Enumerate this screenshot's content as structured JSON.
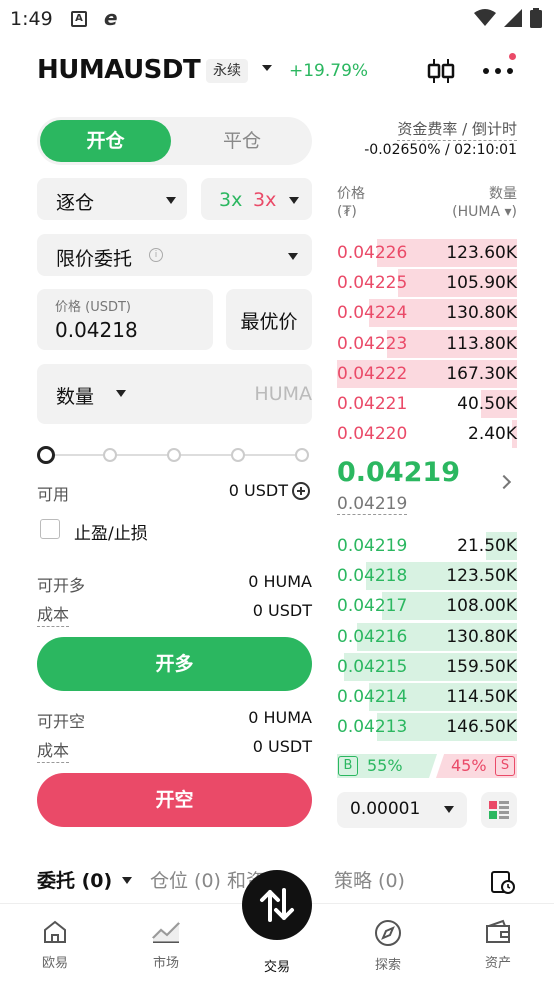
{
  "status_bar": {
    "time": "1:49",
    "icon_a": "A",
    "icon_e": "e"
  },
  "header": {
    "symbol": "HUMAUSDT",
    "contract_type": "永续",
    "change": "+19.79%"
  },
  "toggle": {
    "open": "开仓",
    "close": "平仓"
  },
  "funding": {
    "label": "资金费率 / 倒计时",
    "value": "-0.02650% / 02:10:01"
  },
  "form": {
    "margin_mode": "逐仓",
    "leverage_long": "3x",
    "leverage_short": "3x",
    "order_type": "限价委托",
    "price_label": "价格 (USDT)",
    "price_value": "0.04218",
    "best_price": "最优价",
    "qty_label": "数量",
    "qty_unit": "HUMA",
    "available_label": "可用",
    "available_value": "0 USDT",
    "tpsl_label": "止盈/止损",
    "long_max_label": "可开多",
    "long_max_value": "0 HUMA",
    "long_cost_label": "成本",
    "long_cost_value": "0 USDT",
    "long_button": "开多",
    "short_max_label": "可开空",
    "short_max_value": "0 HUMA",
    "short_cost_label": "成本",
    "short_cost_value": "0 USDT",
    "short_button": "开空"
  },
  "orderbook": {
    "price_header": "价格",
    "price_unit": "(₮)",
    "qty_header": "数量",
    "qty_unit": "(HUMA ▾)",
    "asks": [
      {
        "price": "0.04226",
        "qty": "123.60K",
        "depth": 0.78
      },
      {
        "price": "0.04225",
        "qty": "105.90K",
        "depth": 0.66
      },
      {
        "price": "0.04224",
        "qty": "130.80K",
        "depth": 0.82
      },
      {
        "price": "0.04223",
        "qty": "113.80K",
        "depth": 0.72
      },
      {
        "price": "0.04222",
        "qty": "167.30K",
        "depth": 1.0
      },
      {
        "price": "0.04221",
        "qty": "40.50K",
        "depth": 0.2
      },
      {
        "price": "0.04220",
        "qty": "2.40K",
        "depth": 0.03
      }
    ],
    "last_price": "0.04219",
    "mark_price": "0.04219",
    "bids": [
      {
        "price": "0.04219",
        "qty": "21.50K",
        "depth": 0.17
      },
      {
        "price": "0.04218",
        "qty": "123.50K",
        "depth": 0.84
      },
      {
        "price": "0.04217",
        "qty": "108.00K",
        "depth": 0.75
      },
      {
        "price": "0.04216",
        "qty": "130.80K",
        "depth": 0.89
      },
      {
        "price": "0.04215",
        "qty": "159.50K",
        "depth": 0.96
      },
      {
        "price": "0.04214",
        "qty": "114.50K",
        "depth": 0.82
      },
      {
        "price": "0.04213",
        "qty": "146.50K",
        "depth": 0.78
      }
    ],
    "buy_badge": "B",
    "buy_pct": "55%",
    "sell_pct": "45%",
    "sell_badge": "S",
    "precision": "0.00001"
  },
  "bottom_tabs": {
    "orders": "委托 (0)",
    "positions": "仓位 (0) 和资产",
    "strategy": "策略 (0)"
  },
  "nav": [
    {
      "label": "欧易",
      "icon": "home-icon"
    },
    {
      "label": "市场",
      "icon": "market-chart-icon"
    },
    {
      "label": "交易",
      "icon": "trade-swap-icon"
    },
    {
      "label": "探索",
      "icon": "compass-icon"
    },
    {
      "label": "资产",
      "icon": "wallet-icon"
    }
  ],
  "colors": {
    "green": "#2bb760",
    "red": "#ea4a68"
  }
}
